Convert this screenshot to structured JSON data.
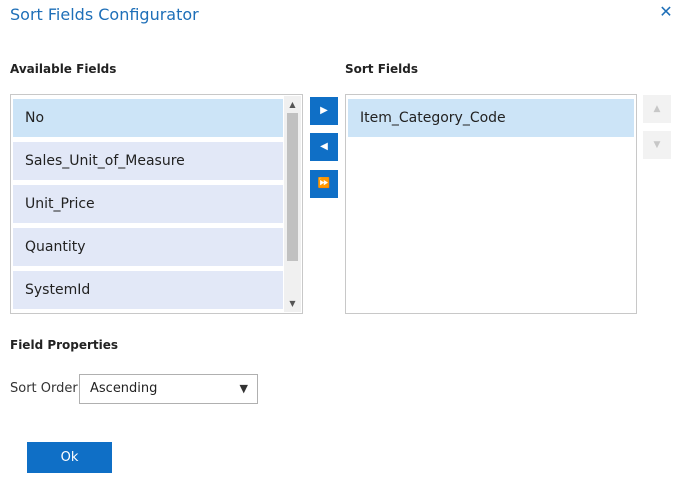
{
  "dialog": {
    "title": "Sort Fields Configurator",
    "close_icon": "close-icon"
  },
  "available_fields": {
    "label": "Available Fields",
    "items": [
      {
        "label": "No",
        "selected": true
      },
      {
        "label": "Sales_Unit_of_Measure",
        "selected": false
      },
      {
        "label": "Unit_Price",
        "selected": false
      },
      {
        "label": "Quantity",
        "selected": false
      },
      {
        "label": "SystemId",
        "selected": false
      }
    ]
  },
  "sort_fields": {
    "label": "Sort Fields",
    "items": [
      {
        "label": "Item_Category_Code",
        "selected": true
      }
    ]
  },
  "move_buttons": {
    "add": "▶",
    "remove": "◀",
    "add_all": "⏩"
  },
  "order_buttons": {
    "up": "▲",
    "down": "▼"
  },
  "field_properties": {
    "label": "Field Properties",
    "sort_order_label": "Sort Order",
    "sort_order_value": "Ascending"
  },
  "footer": {
    "ok_label": "Ok"
  },
  "colors": {
    "accent": "#0f6fc6",
    "title": "#1e6fb8",
    "list_item": "#e2e8f7",
    "list_item_selected": "#cce4f7"
  }
}
